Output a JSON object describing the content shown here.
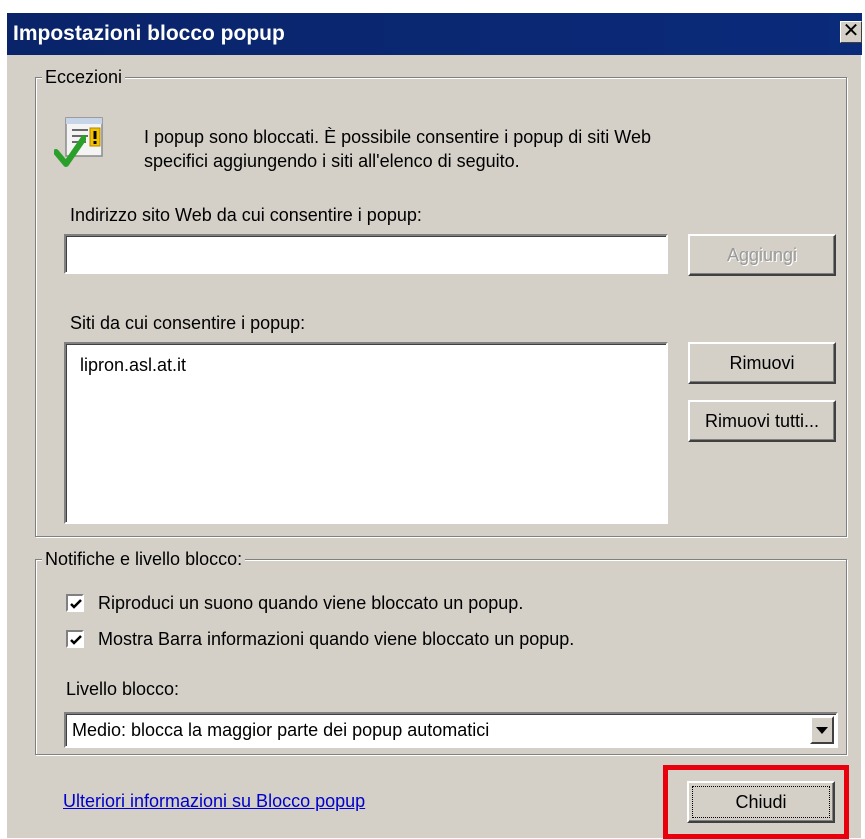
{
  "window": {
    "title": "Impostazioni blocco popup",
    "close_glyph": "✕"
  },
  "exceptions": {
    "legend": "Eccezioni",
    "info_line1": "I popup sono bloccati. È possibile consentire i popup di siti Web",
    "info_line2": "specifici aggiungendo i siti all'elenco di seguito.",
    "address_label": "Indirizzo sito Web da cui consentire i popup:",
    "address_value": "",
    "add_button": "Aggiungi",
    "sites_label": "Siti da cui consentire i popup:",
    "sites": [
      "lipron.asl.at.it"
    ],
    "remove_button": "Rimuovi",
    "remove_all_button": "Rimuovi tutti..."
  },
  "notifications": {
    "legend": "Notifiche e livello blocco:",
    "play_sound_label": "Riproduci un suono quando viene bloccato un popup.",
    "play_sound_checked": true,
    "show_infobar_label": "Mostra Barra informazioni quando viene bloccato un popup.",
    "show_infobar_checked": true,
    "level_label": "Livello blocco:",
    "level_value": "Medio: blocca la maggior parte dei popup automatici"
  },
  "footer": {
    "help_link": "Ulteriori informazioni su Blocco popup",
    "close_button": "Chiudi"
  },
  "colors": {
    "titlebar": "#0a246a",
    "face": "#d4d0c8",
    "link": "#0000cc",
    "highlight": "#e8000c"
  },
  "icons": [
    "popup-info-icon",
    "check-mark-icon",
    "dropdown-arrow-icon"
  ]
}
